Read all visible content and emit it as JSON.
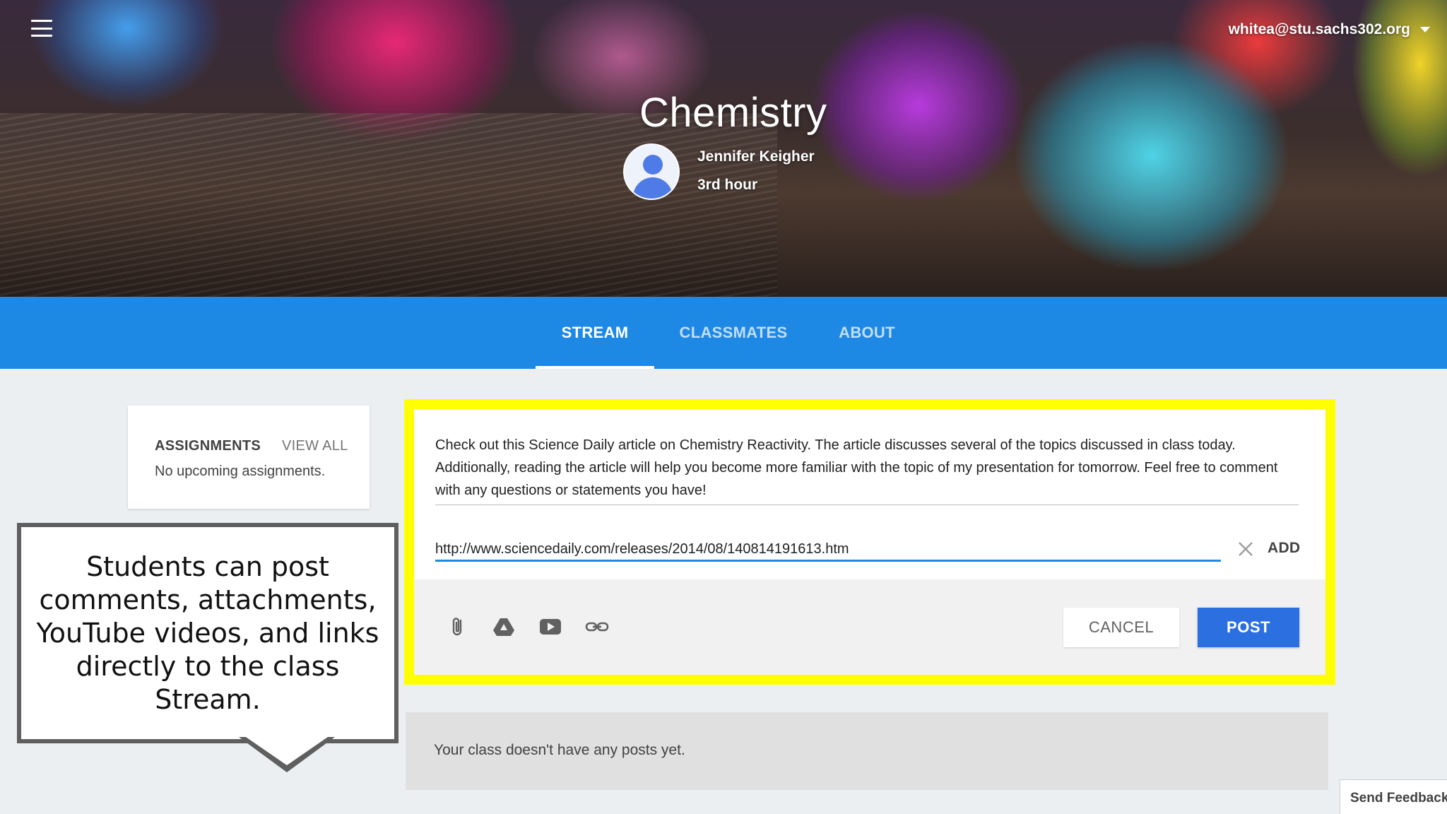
{
  "header": {
    "class_title": "Chemistry",
    "teacher_name": "Jennifer Keigher",
    "section": "3rd hour",
    "account_email": "whitea@stu.sachs302.org"
  },
  "tabs": [
    {
      "label": "STREAM",
      "active": true
    },
    {
      "label": "CLASSMATES",
      "active": false
    },
    {
      "label": "ABOUT",
      "active": false
    }
  ],
  "assignments": {
    "title": "ASSIGNMENTS",
    "view_all": "VIEW ALL",
    "empty": "No upcoming assignments."
  },
  "composer": {
    "text": "Check out this Science Daily article on Chemistry Reactivity. The article discusses several of the topics discussed in class today. Additionally, reading the article will help you become more familiar with the topic of my presentation for tomorrow. Feel free to comment with any questions or statements you have!",
    "link_value": "http://www.sciencedaily.com/releases/2014/08/140814191613.htm",
    "add_label": "ADD",
    "cancel_label": "CANCEL",
    "post_label": "POST",
    "tools": [
      "paperclip-icon",
      "drive-icon",
      "youtube-icon",
      "link-icon"
    ],
    "highlight_color": "#ffff00",
    "accent_color": "#1e88e5"
  },
  "callout": {
    "text": "Students can post comments, attachments, YouTube videos, and links directly to the class Stream."
  },
  "stream": {
    "empty": "Your class doesn't have any posts yet."
  },
  "feedback_label": "Send Feedback",
  "colors": {
    "tab_bar": "#1e88e5",
    "post_button": "#2b6fe0",
    "page_bg": "#eceff1"
  }
}
